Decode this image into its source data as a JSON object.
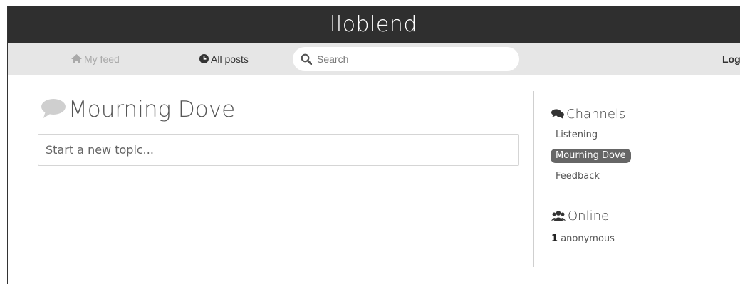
{
  "site": {
    "title": "lloblend"
  },
  "nav": {
    "my_feed": "My feed",
    "all_posts": "All posts",
    "search_placeholder": "Search",
    "login": "Log in"
  },
  "main": {
    "channel_title": "Mourning Dove",
    "new_topic_placeholder": "Start a new topic..."
  },
  "sidebar": {
    "channels_heading": "Channels",
    "channels": [
      {
        "label": "Listening",
        "active": false
      },
      {
        "label": "Mourning Dove",
        "active": true
      },
      {
        "label": "Feedback",
        "active": false
      }
    ],
    "online_heading": "Online",
    "online_count": "1",
    "online_label": "anonymous"
  },
  "icons": {
    "home": "home-icon",
    "clock": "clock-icon",
    "search": "search-icon",
    "comment": "comment-icon",
    "comments": "comments-icon",
    "users": "users-icon"
  },
  "colors": {
    "header_bg": "#2f2f2f",
    "navbar_bg": "#e6e6e6",
    "active_channel_bg": "#666666"
  }
}
